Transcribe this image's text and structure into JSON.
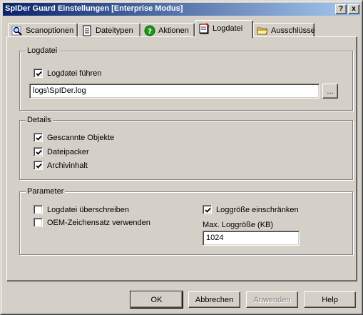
{
  "window": {
    "title": "SpIDer Guard Einstellungen [Enterprise Modus]",
    "help_glyph": "?",
    "close_glyph": "x"
  },
  "tabs": [
    {
      "label": "Scanoptionen",
      "icon": "magnifier-icon",
      "active": false
    },
    {
      "label": "Dateitypen",
      "icon": "document-icon",
      "active": false
    },
    {
      "label": "Aktionen",
      "icon": "help-circle-icon",
      "active": false
    },
    {
      "label": "Logdatei",
      "icon": "notebook-icon",
      "active": true
    },
    {
      "label": "Ausschlüsse",
      "icon": "folder-icon",
      "active": false
    }
  ],
  "logdatei_group": {
    "title": "Logdatei",
    "keep_log": {
      "label": "Logdatei führen",
      "checked": true
    },
    "path_value": "logs\\SpIDer.log",
    "browse_label": "..."
  },
  "details_group": {
    "title": "Details",
    "items": [
      {
        "label": "Gescannte Objekte",
        "checked": true
      },
      {
        "label": "Dateipacker",
        "checked": true
      },
      {
        "label": "Archivinhalt",
        "checked": true
      }
    ]
  },
  "parameter_group": {
    "title": "Parameter",
    "overwrite": {
      "label": "Logdatei überschreiben",
      "checked": false
    },
    "oem_charset": {
      "label": "OEM-Zeichensatz verwenden",
      "checked": false
    },
    "limit_size": {
      "label": "Loggröße einschränken",
      "checked": true
    },
    "max_size_label": "Max. Loggröße (KB)",
    "max_size_value": "1024"
  },
  "buttons": {
    "ok": "OK",
    "cancel": "Abbrechen",
    "apply": "Anwenden",
    "help": "Help"
  },
  "colors": {
    "face": "#d4d0c8",
    "title_start": "#0a246a",
    "title_end": "#a6caf0"
  }
}
